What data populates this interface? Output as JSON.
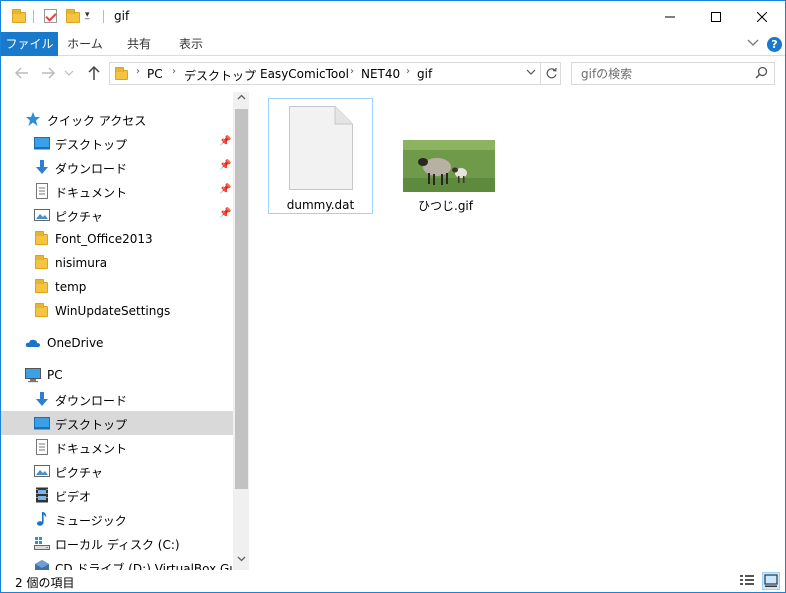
{
  "window": {
    "title": "gif",
    "colors": {
      "accent": "#1979ca",
      "selection": "#d9d9d9",
      "folder": "#f5c542"
    }
  },
  "ribbon": {
    "tabs": [
      {
        "label": "ファイル"
      },
      {
        "label": "ホーム"
      },
      {
        "label": "共有"
      },
      {
        "label": "表示"
      }
    ],
    "help_label": "?"
  },
  "address": {
    "crumbs": [
      "PC",
      "デスクトップ",
      "EasyComicTool",
      "NET40",
      "gif"
    ]
  },
  "search": {
    "placeholder": "gifの検索"
  },
  "nav": {
    "quick_access": {
      "label": "クイック アクセス",
      "icon": "star-icon"
    },
    "quick_items": [
      {
        "label": "デスクトップ",
        "icon": "desktop-icon",
        "pinned": true
      },
      {
        "label": "ダウンロード",
        "icon": "download-icon",
        "pinned": true
      },
      {
        "label": "ドキュメント",
        "icon": "document-icon",
        "pinned": true
      },
      {
        "label": "ピクチャ",
        "icon": "picture-icon",
        "pinned": true
      },
      {
        "label": "Font_Office2013",
        "icon": "folder-icon",
        "pinned": false
      },
      {
        "label": "nisimura",
        "icon": "folder-icon",
        "pinned": false
      },
      {
        "label": "temp",
        "icon": "folder-icon",
        "pinned": false
      },
      {
        "label": "WinUpdateSettings",
        "icon": "folder-icon",
        "pinned": false
      }
    ],
    "onedrive": {
      "label": "OneDrive",
      "icon": "cloud-icon"
    },
    "pc": {
      "label": "PC",
      "icon": "computer-icon"
    },
    "pc_items": [
      {
        "label": "ダウンロード",
        "icon": "download-icon",
        "selected": false
      },
      {
        "label": "デスクトップ",
        "icon": "desktop-icon",
        "selected": true
      },
      {
        "label": "ドキュメント",
        "icon": "document-icon",
        "selected": false
      },
      {
        "label": "ピクチャ",
        "icon": "picture-icon",
        "selected": false
      },
      {
        "label": "ビデオ",
        "icon": "video-icon",
        "selected": false
      },
      {
        "label": "ミュージック",
        "icon": "music-icon",
        "selected": false
      },
      {
        "label": "ローカル ディスク (C:)",
        "icon": "disk-icon",
        "selected": false
      },
      {
        "label": "CD ドライブ (D:) VirtualBox Guest Ac",
        "icon": "cd-drive-icon",
        "selected": false
      }
    ]
  },
  "files": [
    {
      "name": "dummy.dat",
      "icon": "blank-file-icon",
      "selected": true
    },
    {
      "name": "ひつじ.gif",
      "icon": "sheep-thumbnail",
      "selected": false
    }
  ],
  "status": {
    "item_count": "2 個の項目"
  }
}
